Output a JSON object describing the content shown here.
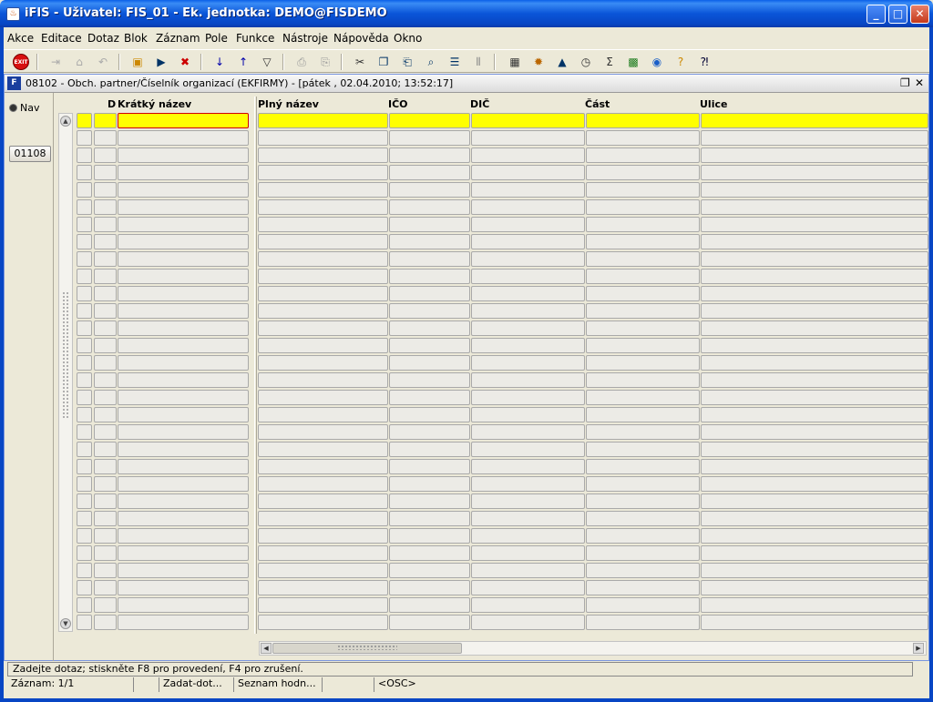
{
  "window": {
    "title": "iFIS - Uživatel: FIS_01 - Ek. jednotka: DEMO@FISDEMO",
    "app_icon_glyph": "♨"
  },
  "menu": [
    {
      "label": "Akce"
    },
    {
      "label": "Editace"
    },
    {
      "label": "Dotaz"
    },
    {
      "label": "Blok"
    },
    {
      "label": "Záznam"
    },
    {
      "label": "Pole"
    },
    {
      "label": "Funkce"
    },
    {
      "label": "Nástroje"
    },
    {
      "label": "Nápověda"
    },
    {
      "label": "Okno"
    }
  ],
  "toolbar": {
    "exit_label": "EXIT",
    "icons": [
      "new-record-icon",
      "save-icon",
      "rollback-icon",
      "query-enter-icon",
      "query-execute-icon",
      "query-cancel-icon",
      "sort-asc-icon",
      "sort-desc-icon",
      "filter-icon",
      "print-icon",
      "print-preview-icon",
      "cut-icon",
      "copy-icon",
      "paste-icon",
      "find-icon",
      "list-icon",
      "columns-icon",
      "calculator-icon",
      "settings-icon",
      "chart-icon",
      "clock-icon",
      "sum-icon",
      "excel-icon",
      "browser-icon",
      "help-icon",
      "whats-this-icon"
    ]
  },
  "form": {
    "title": "08102 - Obch. partner/Číselník organizací (EKFIRMY) - [pátek  , 02.04.2010; 13:52:17]",
    "icon_text": "F",
    "nav_label": "Nav",
    "side_button": "01108",
    "columns": {
      "d": "D",
      "short_name": "Krátký název",
      "full_name": "Plný název",
      "ico": "IČO",
      "dic": "DIČ",
      "part": "Část",
      "street": "Ulice"
    },
    "row_count": 30
  },
  "status": {
    "message": "Zadejte dotaz; stiskněte F8 pro provedení, F4 pro zrušení.",
    "record": "Záznam: 1/1",
    "seg2": "",
    "mode": "Zadat-dot...",
    "lov": "Seznam hodn...",
    "seg5": "",
    "osc": "<OSC>"
  },
  "colors": {
    "highlight_row": "#ffff00",
    "focus_border": "#d00000",
    "titlebar": "#0a55d8"
  }
}
